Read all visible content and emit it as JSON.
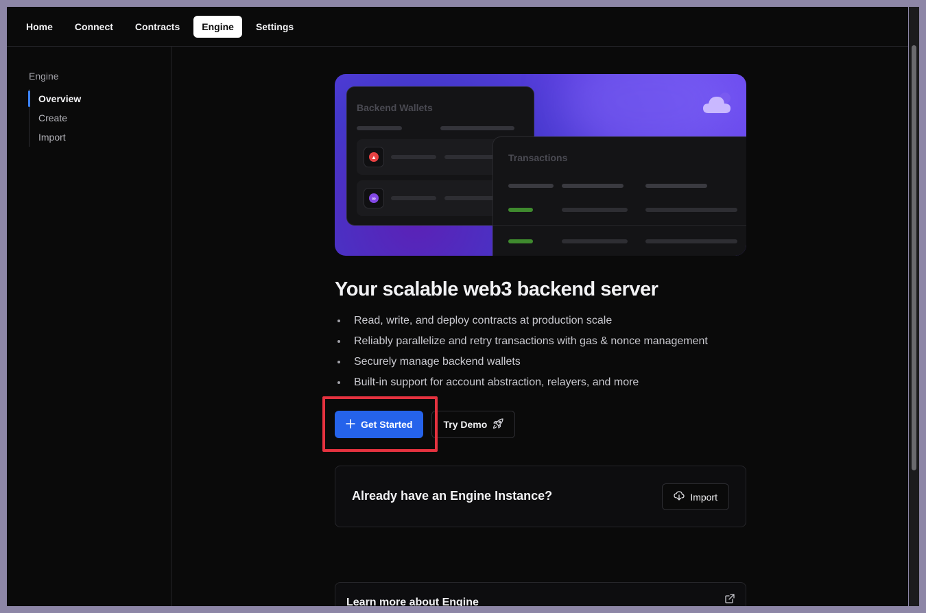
{
  "topnav": {
    "tabs": [
      {
        "label": "Home",
        "active": false
      },
      {
        "label": "Connect",
        "active": false
      },
      {
        "label": "Contracts",
        "active": false
      },
      {
        "label": "Engine",
        "active": true
      },
      {
        "label": "Settings",
        "active": false
      }
    ]
  },
  "sidebar": {
    "heading": "Engine",
    "items": [
      {
        "label": "Overview",
        "active": true
      },
      {
        "label": "Create",
        "active": false
      },
      {
        "label": "Import",
        "active": false
      }
    ]
  },
  "hero": {
    "wallets_title": "Backend Wallets",
    "transactions_title": "Transactions",
    "icons": [
      "avalanche-icon",
      "polygon-icon",
      "cloud-icon"
    ]
  },
  "main": {
    "headline": "Your scalable web3 backend server",
    "features": [
      "Read, write, and deploy contracts at production scale",
      "Reliably parallelize and retry transactions with gas & nonce management",
      "Securely manage backend wallets",
      "Built-in support for account abstraction, relayers, and more"
    ],
    "get_started_label": "Get Started",
    "try_demo_label": "Try Demo",
    "import_card_title": "Already have an Engine Instance?",
    "import_button_label": "Import",
    "learn_more_title": "Learn more about Engine"
  },
  "colors": {
    "accent": "#2563eb",
    "highlight": "#e5323f",
    "background": "#0a0a0a"
  }
}
